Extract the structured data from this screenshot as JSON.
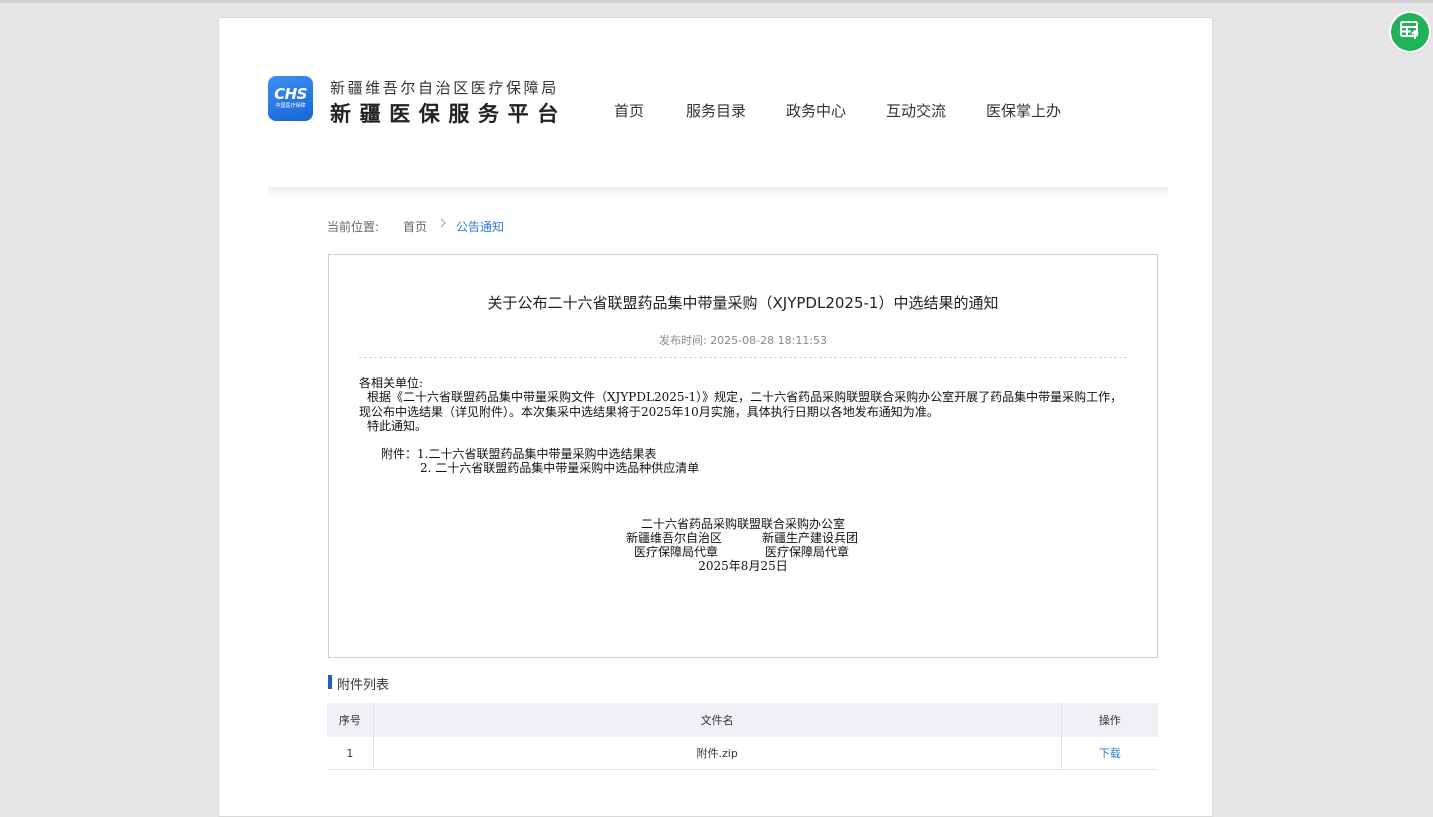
{
  "header": {
    "logo_text": "CHS",
    "logo_sub": "中国医疗保障",
    "org_sub": "新疆维吾尔自治区医疗保障局",
    "org_main": "新疆医保服务平台"
  },
  "nav": {
    "items": [
      "首页",
      "服务目录",
      "政务中心",
      "互动交流",
      "医保掌上办"
    ]
  },
  "breadcrumb": {
    "label": "当前位置:",
    "home": "首页",
    "current": "公告通知"
  },
  "article": {
    "title": "关于公布二十六省联盟药品集中带量采购（XJYPDL2025-1）中选结果的通知",
    "publish_label": "发布时间:",
    "publish_time": "2025-08-28 18:11:53",
    "salutation": "各相关单位:",
    "para1_line1": "根据《二十六省联盟药品集中带量采购文件（XJYPDL2025-1）》规定，二十六省药品采购联盟联合采购办公室开展了药品集中带量采购工作，",
    "para1_line2": "现公布中选结果（详见附件）。本次集采中选结果将于2025年10月实施，具体执行日期以各地发布通知为准。",
    "closing": "特此通知。",
    "attach_label": "附件：1.二十六省联盟药品集中带量采购中选结果表",
    "attach_2": "2. 二十六省联盟药品集中带量采购中选品种供应清单",
    "sign_office": "二十六省药品采购联盟联合采购办公室",
    "sign_left_1": "新疆维吾尔自治区",
    "sign_right_1": "新疆生产建设兵团",
    "sign_left_2": "医疗保障局代章",
    "sign_right_2": "医疗保障局代章",
    "sign_date": "2025年8月25日"
  },
  "attachments": {
    "title": "附件列表",
    "columns": [
      "序号",
      "文件名",
      "操作"
    ],
    "rows": [
      {
        "index": "1",
        "filename": "附件.zip",
        "action": "下载"
      }
    ]
  },
  "colors": {
    "accent": "#2f7ed8",
    "logo": "#1565d8",
    "floating_button": "#20b35a"
  }
}
